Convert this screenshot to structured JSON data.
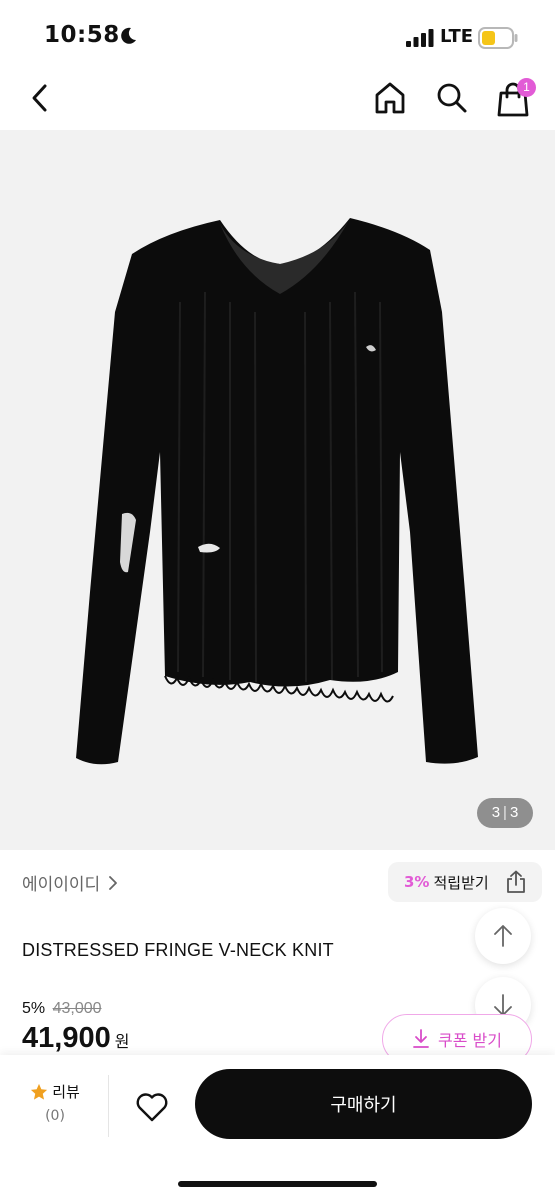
{
  "status": {
    "time": "10:58",
    "network": "LTE",
    "icons": [
      "moon-icon",
      "signal-icon",
      "battery-icon"
    ]
  },
  "nav": {
    "icons": [
      "back-icon",
      "home-icon",
      "search-icon",
      "shopping-bag-icon"
    ],
    "cart_badge": "1"
  },
  "gallery": {
    "current": "3",
    "separator": "|",
    "total": "3"
  },
  "product": {
    "brand": "에이이이디",
    "points_rate": "3%",
    "points_label": "적립받기",
    "title": "DISTRESSED FRINGE V-NECK KNIT",
    "discount_rate": "5%",
    "original_price": "43,000",
    "final_price": "41,900",
    "currency": "원"
  },
  "actions": {
    "coupon_label": "쿠폰 받기",
    "review_label": "리뷰",
    "review_count": "(0)",
    "buy_label": "구매하기"
  },
  "colors": {
    "accent": "#e25bd6",
    "buy_button": "#0d0d0d",
    "image_background": "#f2f2f2",
    "review_star": "#f0a020"
  }
}
